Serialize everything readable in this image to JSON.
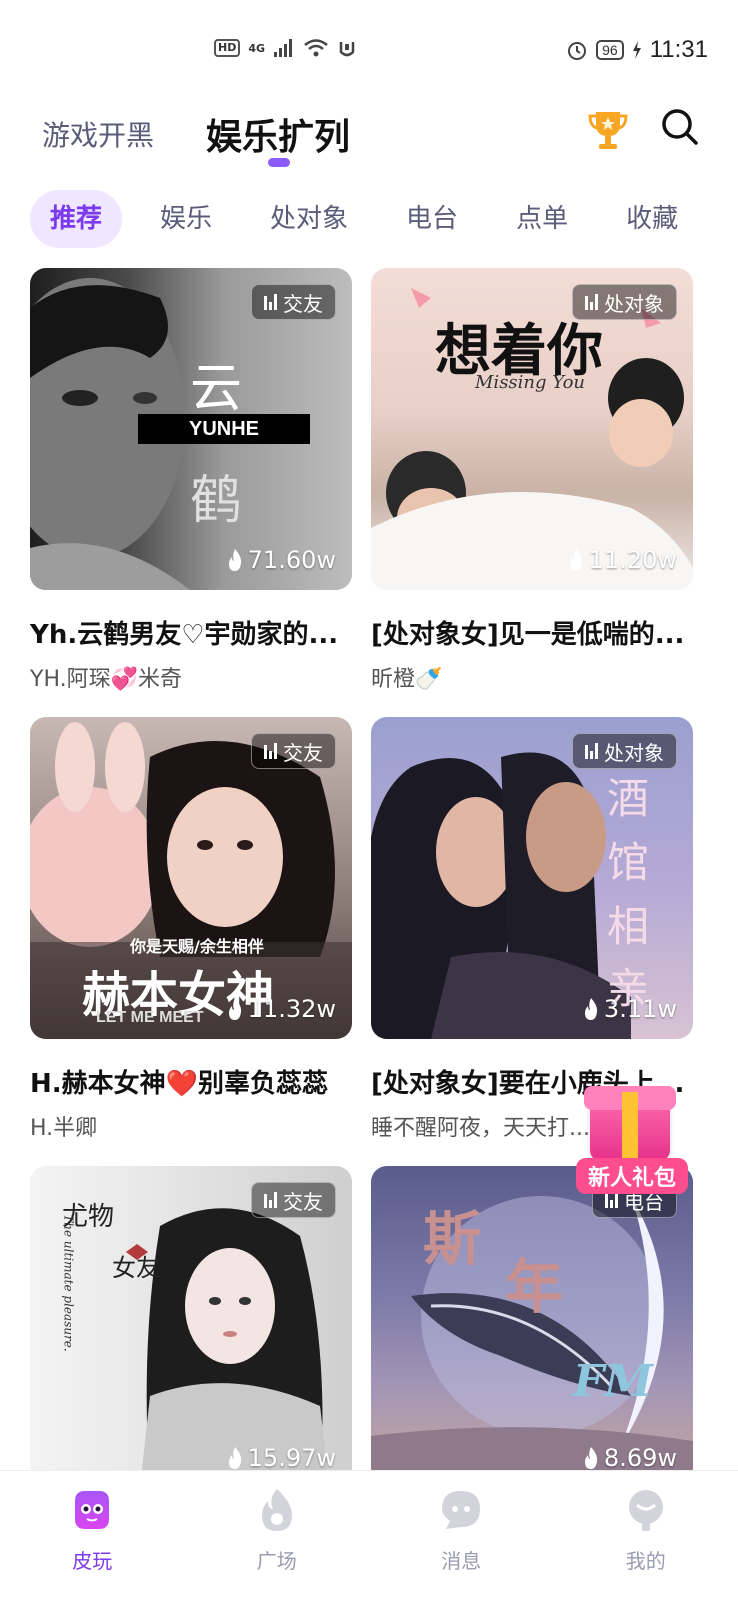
{
  "status_bar": {
    "network_badge": "HD",
    "network_type": "4G",
    "battery": "96",
    "time": "11:31"
  },
  "header": {
    "tabs": [
      {
        "label": "游戏开黑",
        "active": false
      },
      {
        "label": "娱乐扩列",
        "active": true
      }
    ],
    "icons": [
      "trophy-icon",
      "search-icon"
    ]
  },
  "categories": [
    {
      "label": "推荐",
      "active": true
    },
    {
      "label": "娱乐",
      "active": false
    },
    {
      "label": "处对象",
      "active": false
    },
    {
      "label": "电台",
      "active": false
    },
    {
      "label": "点单",
      "active": false
    },
    {
      "label": "收藏",
      "active": false
    }
  ],
  "rooms": [
    {
      "tag": "交友",
      "heat": "71.60w",
      "title": "Yh.云鹤男友♡宇勋家的...",
      "host": "YH.阿琛💞米奇",
      "art_text": [
        "云",
        "YUNHE",
        "鹤"
      ]
    },
    {
      "tag": "处对象",
      "heat": "11.20w",
      "title": "[处对象女]见一是低喘的...",
      "host": "昕橙🍼",
      "art_text": [
        "想着你",
        "Missing You"
      ]
    },
    {
      "tag": "交友",
      "heat": "11.32w",
      "title": "H.赫本女神❤️别辜负蕊蕊",
      "host": "H.半卿",
      "art_text": [
        "你是天赐/余生相伴",
        "赫本女神",
        "LET ME MEET"
      ]
    },
    {
      "tag": "处对象",
      "heat": "3.11w",
      "title": "[处对象女]要在小鹿头上...",
      "host": "睡不醒阿夜，天天打...",
      "art_text": [
        "酒",
        "馆",
        "相",
        "亲"
      ]
    },
    {
      "tag": "交友",
      "heat": "15.97w",
      "title": "",
      "host": "",
      "art_text": [
        "尤物",
        "女友",
        "The ultimate pleasure."
      ]
    },
    {
      "tag": "电台",
      "heat": "8.69w",
      "title": "",
      "host": "",
      "art_text": [
        "斯",
        "年",
        "FM"
      ]
    }
  ],
  "gift_badge": {
    "label": "新人礼包"
  },
  "bottom_nav": [
    {
      "label": "皮玩",
      "icon": "pipi-face-icon",
      "active": true
    },
    {
      "label": "广场",
      "icon": "flame-icon",
      "active": false
    },
    {
      "label": "消息",
      "icon": "chat-bubble-icon",
      "active": false
    },
    {
      "label": "我的",
      "icon": "profile-icon",
      "active": false
    }
  ],
  "colors": {
    "accent": "#7c3aed",
    "chip_active_bg": "#efe7ff",
    "gift_pink": "#ff4d8d",
    "inactive_text": "#5c5c7a"
  }
}
